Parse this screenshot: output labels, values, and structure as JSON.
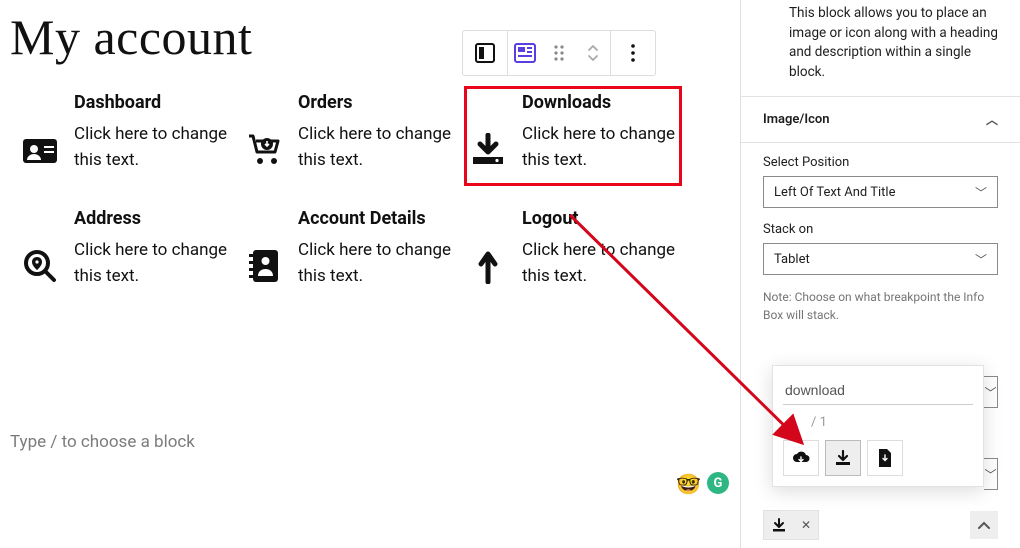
{
  "page": {
    "title": "My account"
  },
  "toolbar_icons": [
    "layout",
    "infobox",
    "drag",
    "move",
    "more"
  ],
  "info_boxes": [
    {
      "title": "Dashboard",
      "desc": "Click here to change this text.",
      "icon": "id-card"
    },
    {
      "title": "Orders",
      "desc": "Click here to change this text.",
      "icon": "cart-download"
    },
    {
      "title": "Downloads",
      "desc": "Click here to change this text.",
      "icon": "download",
      "selected": true
    },
    {
      "title": "Address",
      "desc": "Click here to change this text.",
      "icon": "map-search"
    },
    {
      "title": "Account Details",
      "desc": "Click here to change this text.",
      "icon": "contact-book"
    },
    {
      "title": "Logout",
      "desc": "Click here to change this text.",
      "icon": "arrow-up"
    }
  ],
  "placeholder": "Type / to choose a block",
  "sidebar": {
    "block_desc": "This block allows you to place an image or icon along with a heading and description within a single block.",
    "panel_title": "Image/Icon",
    "position_label": "Select Position",
    "position_value": "Left Of Text And Title",
    "stack_label": "Stack on",
    "stack_value": "Tablet",
    "stack_note": "Note: Choose on what breakpoint the Info Box will stack.",
    "selected_icon": "download"
  },
  "icon_picker": {
    "search_value": "download",
    "pager": "/  1",
    "icons": [
      "cloud-download",
      "download",
      "file-download"
    ],
    "selected_index": 1
  }
}
